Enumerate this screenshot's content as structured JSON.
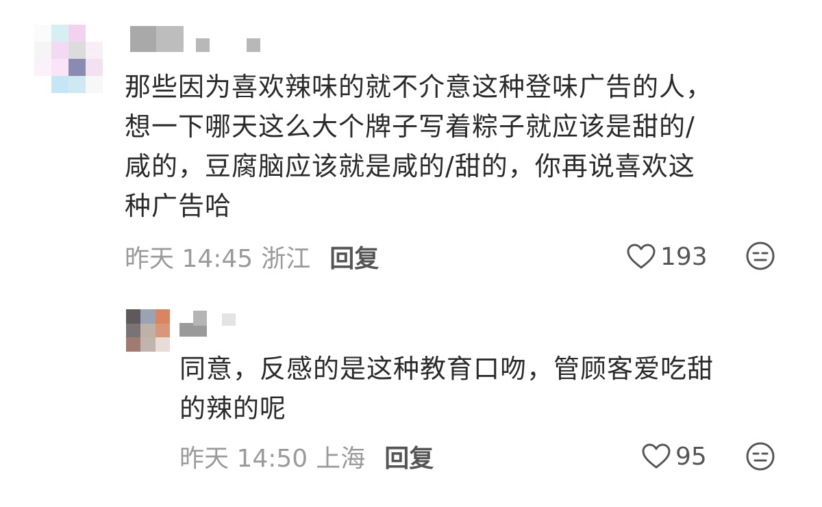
{
  "comments": [
    {
      "text_lines": [
        "那些因为喜欢辣味的就不介意这种登味广告的人，",
        "想一下哪天这么大个牌子写着粽子就应该是甜的/",
        "咸的，豆腐脑应该就是咸的/甜的，你再说喜欢这",
        "种广告哈"
      ],
      "time": "昨天 14:45",
      "location": "浙江",
      "reply_label": "回复",
      "likes": "193",
      "like_icon": "heart-outline-icon",
      "dislike_icon": "meh-face-icon"
    },
    {
      "text_lines": [
        "同意，反感的是这种教育口吻，管顾客爱吃甜",
        "的辣的呢"
      ],
      "time": "昨天 14:50",
      "location": "上海",
      "reply_label": "回复",
      "likes": "95",
      "like_icon": "heart-outline-icon",
      "dislike_icon": "meh-face-icon"
    }
  ]
}
